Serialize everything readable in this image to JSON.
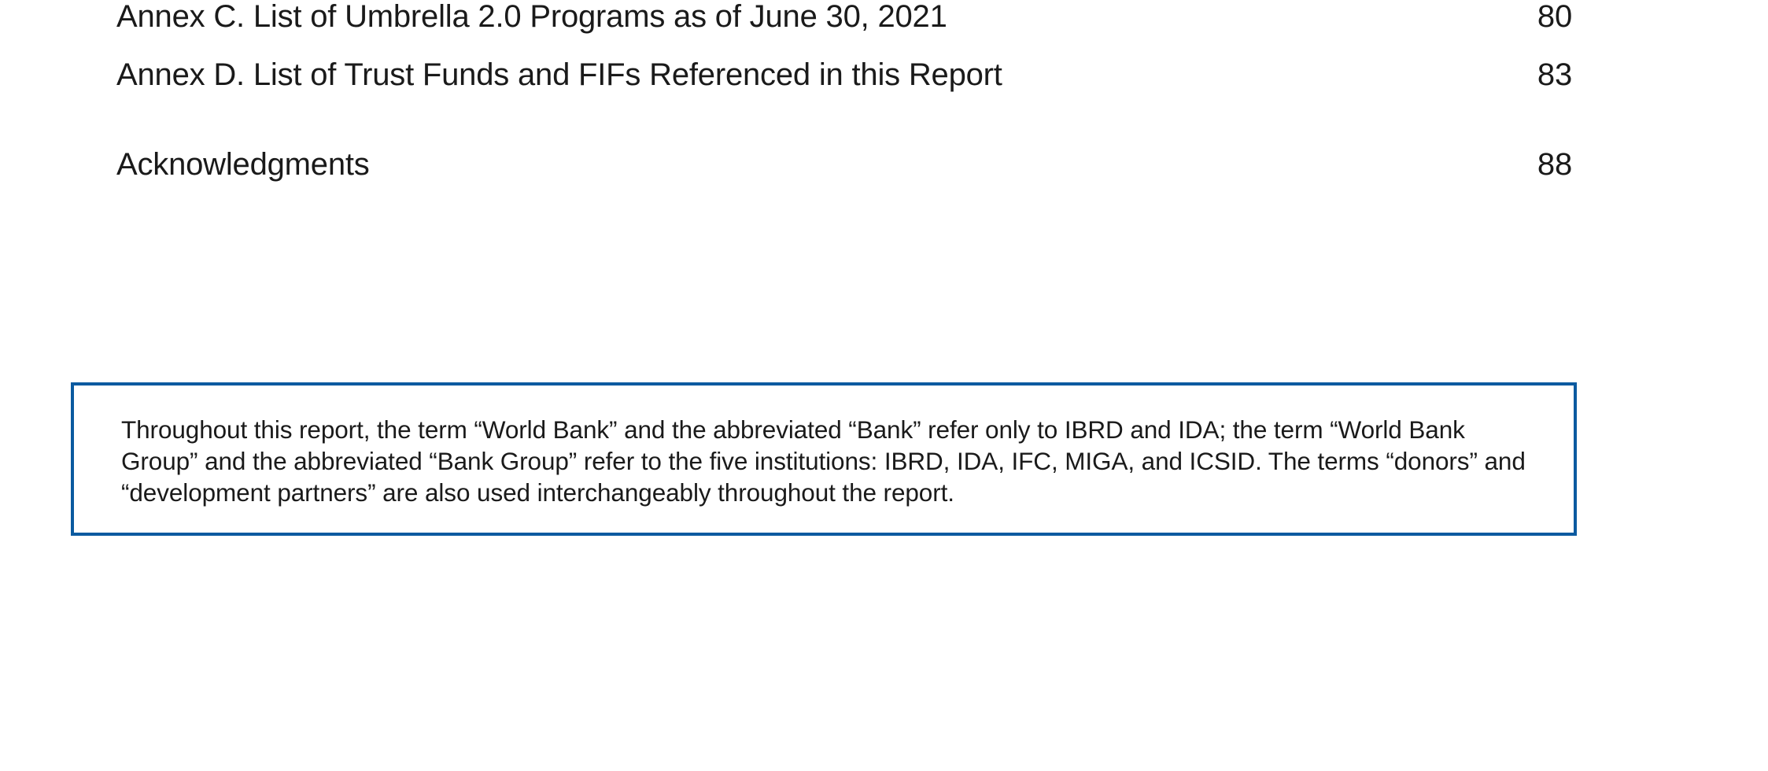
{
  "toc": {
    "entries": [
      {
        "title": "Annex C. List of Umbrella 2.0 Programs as of June 30, 2021",
        "page": "80"
      },
      {
        "title": "Annex D. List of Trust Funds and FIFs Referenced in this Report",
        "page": "83"
      },
      {
        "title": "Acknowledgments",
        "page": "88"
      }
    ]
  },
  "note": {
    "text": "Throughout this report, the term “World Bank” and the abbreviated “Bank” refer only to IBRD and IDA; the term “World Bank Group” and the abbreviated “Bank Group” refer to the five institutions: IBRD, IDA, IFC, MIGA, and ICSID. The terms “donors” and “development partners” are also used interchangeably throughout the report.",
    "border_color": "#0b5aa0"
  }
}
